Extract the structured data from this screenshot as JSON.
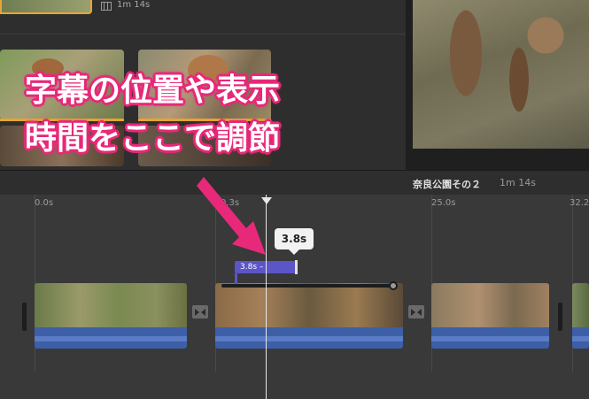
{
  "browser": {
    "top_clip_duration": "1m 14s"
  },
  "annotation": {
    "line1": "字幕の位置や表示",
    "line2": "時間をここで調節",
    "color": "#e8297a"
  },
  "project": {
    "title": "奈良公園その２",
    "duration": "1m 14s"
  },
  "timeline": {
    "ruler_labels": [
      "0.0s",
      "0.3s",
      "25.0s",
      "32.2"
    ],
    "title_clip_label": "3.8s –",
    "tooltip_value": "3.8s",
    "accent_color": "#5b55c7"
  }
}
